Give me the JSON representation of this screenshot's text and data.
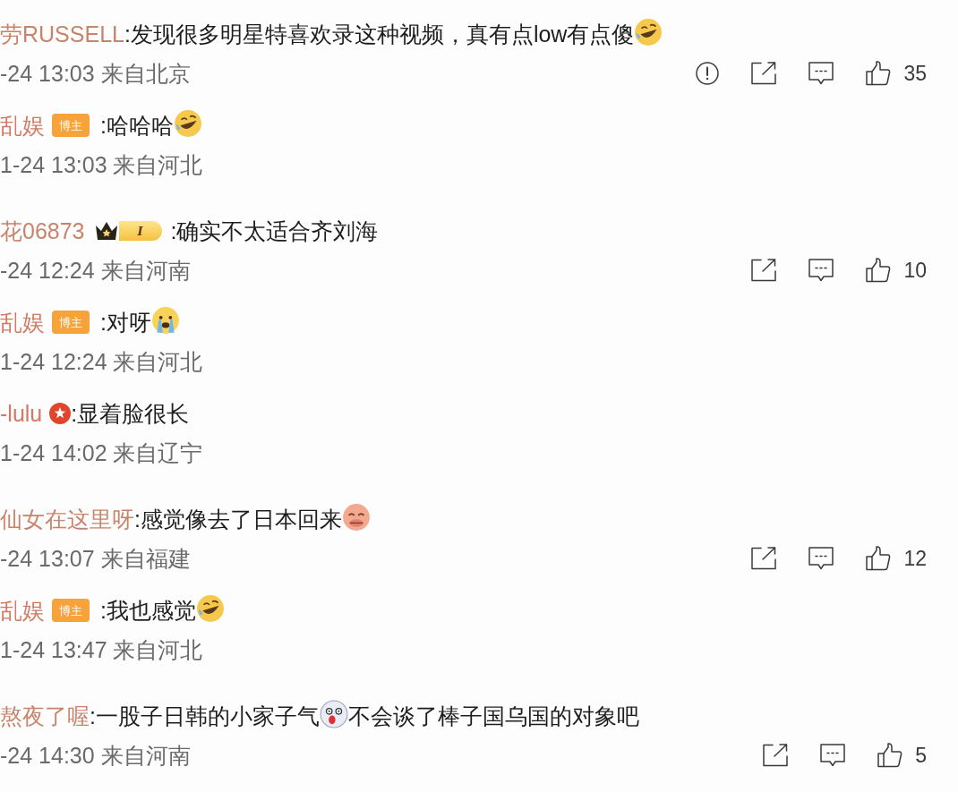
{
  "comments": [
    {
      "kind": "comment",
      "author": "劳RUSSELL",
      "content": [
        {
          "kind": "text",
          "text": ":发现很多明星特喜欢录这种视频，真有点low有点傻"
        },
        {
          "kind": "laugh"
        }
      ],
      "meta": "-24 13:03 来自北京",
      "actions": [
        {
          "kind": "report"
        },
        {
          "kind": "share"
        },
        {
          "kind": "reply"
        },
        {
          "kind": "like",
          "count": "35"
        }
      ]
    },
    {
      "kind": "reply",
      "author": "乱娱",
      "badges": [
        {
          "kind": "role",
          "text": "博主"
        }
      ],
      "content": [
        {
          "kind": "text",
          "text": ":哈哈哈"
        },
        {
          "kind": "laugh"
        }
      ],
      "meta": "1-24 13:03 来自河北"
    },
    {
      "kind": "comment",
      "author": "花06873",
      "badges": [
        {
          "kind": "crown"
        },
        {
          "kind": "level",
          "text": "I"
        }
      ],
      "content": [
        {
          "kind": "text",
          "text": ":确实不太适合齐刘海"
        }
      ],
      "meta": "-24 12:24 来自河南",
      "actions": [
        {
          "kind": "share"
        },
        {
          "kind": "reply"
        },
        {
          "kind": "like",
          "count": "10"
        }
      ]
    },
    {
      "kind": "reply",
      "author": "乱娱",
      "badges": [
        {
          "kind": "role",
          "text": "博主"
        }
      ],
      "content": [
        {
          "kind": "text",
          "text": ":对呀"
        },
        {
          "kind": "cry"
        }
      ],
      "meta": "1-24 12:24 来自河北"
    },
    {
      "kind": "reply",
      "author": "-lulu",
      "badges": [
        {
          "kind": "emblem"
        }
      ],
      "content": [
        {
          "kind": "text",
          "text": ":显着脸很长"
        }
      ],
      "meta": "1-24 14:02 来自辽宁"
    },
    {
      "kind": "comment",
      "author": "仙女在这里呀",
      "content": [
        {
          "kind": "text",
          "text": ":感觉像去了日本回来"
        },
        {
          "kind": "blush"
        }
      ],
      "meta": "-24 13:07 来自福建",
      "actions": [
        {
          "kind": "share"
        },
        {
          "kind": "reply"
        },
        {
          "kind": "like",
          "count": "12"
        }
      ]
    },
    {
      "kind": "reply",
      "author": "乱娱",
      "badges": [
        {
          "kind": "role",
          "text": "博主"
        }
      ],
      "content": [
        {
          "kind": "text",
          "text": ":我也感觉"
        },
        {
          "kind": "laugh"
        }
      ],
      "meta": "1-24 13:47 来自河北"
    },
    {
      "kind": "comment",
      "author": "熬夜了喔",
      "content": [
        {
          "kind": "text",
          "text": ":一股子日韩的小家子气"
        },
        {
          "kind": "shock"
        },
        {
          "kind": "text",
          "text": "不会谈了棒子国乌国的对象吧"
        }
      ],
      "meta": "-24 14:30 来自河南",
      "actions": [
        {
          "kind": "share"
        },
        {
          "kind": "reply"
        },
        {
          "kind": "like",
          "count": "5"
        }
      ]
    }
  ]
}
